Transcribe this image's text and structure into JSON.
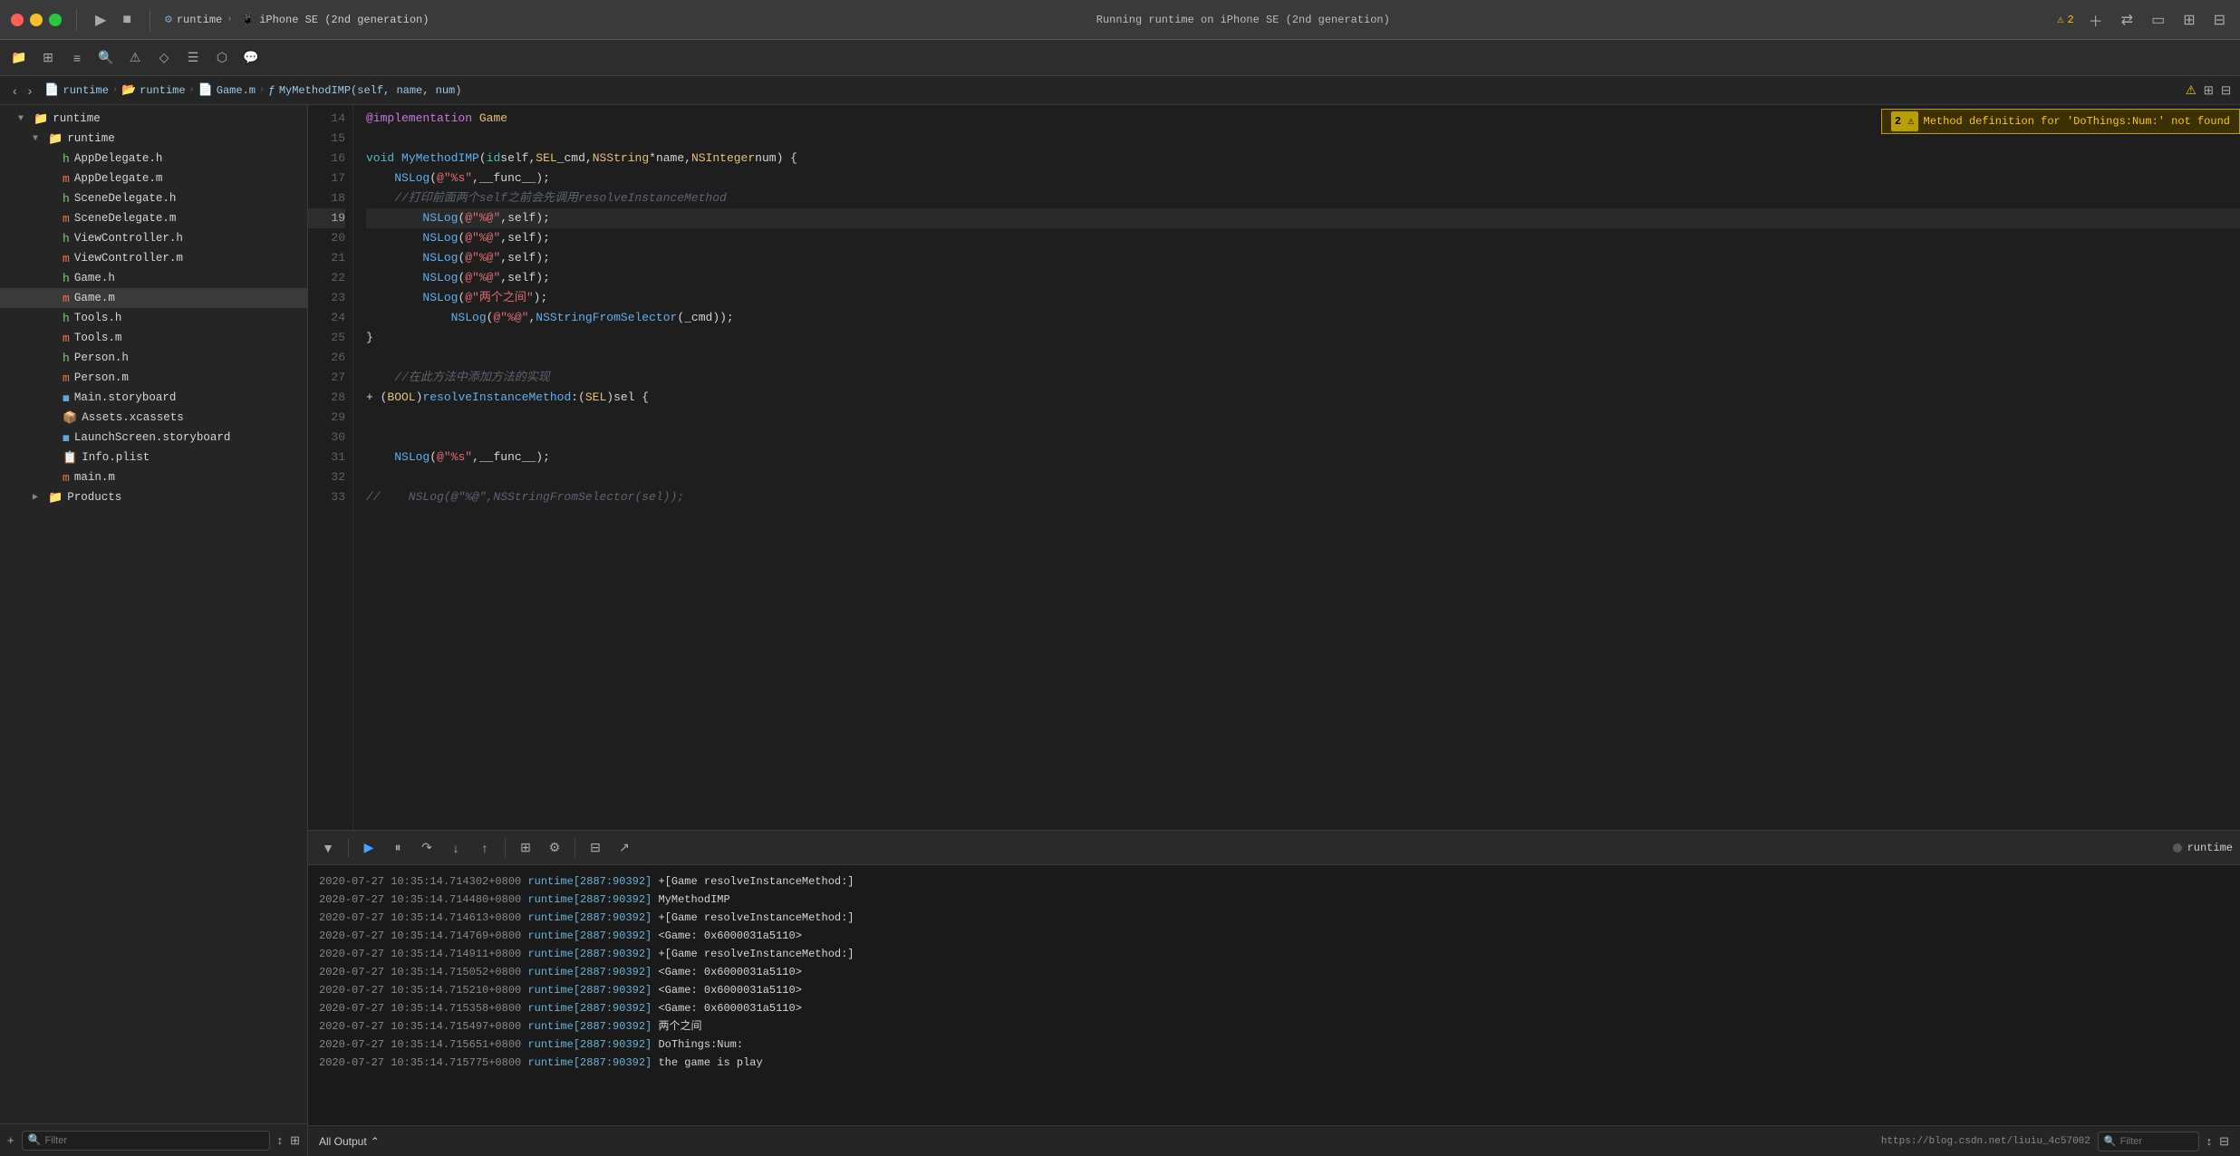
{
  "titleBar": {
    "scheme": "runtime",
    "device": "iPhone SE (2nd generation)",
    "status": "Running runtime on iPhone SE (2nd generation)",
    "warningCount": "2",
    "windowControls": {
      "close": "close",
      "minimize": "minimize",
      "maximize": "maximize"
    }
  },
  "breadcrumb": {
    "items": [
      "runtime",
      "runtime",
      "Game.m",
      "MyMethodIMP(self, name, num)"
    ]
  },
  "sidebar": {
    "rootLabel": "runtime",
    "runtimeLabel": "runtime",
    "files": [
      {
        "name": "AppDelegate.h",
        "type": "h",
        "indent": 2
      },
      {
        "name": "AppDelegate.m",
        "type": "m",
        "indent": 2
      },
      {
        "name": "SceneDelegate.h",
        "type": "h",
        "indent": 2
      },
      {
        "name": "SceneDelegate.m",
        "type": "m",
        "indent": 2
      },
      {
        "name": "ViewController.h",
        "type": "h",
        "indent": 2
      },
      {
        "name": "ViewController.m",
        "type": "m",
        "indent": 2
      },
      {
        "name": "Game.h",
        "type": "h",
        "indent": 2
      },
      {
        "name": "Game.m",
        "type": "m",
        "indent": 2,
        "selected": true
      },
      {
        "name": "Tools.h",
        "type": "h",
        "indent": 2
      },
      {
        "name": "Tools.m",
        "type": "m",
        "indent": 2
      },
      {
        "name": "Person.h",
        "type": "h",
        "indent": 2
      },
      {
        "name": "Person.m",
        "type": "m",
        "indent": 2
      },
      {
        "name": "Main.storyboard",
        "type": "storyboard",
        "indent": 2
      },
      {
        "name": "Assets.xcassets",
        "type": "folder",
        "indent": 2
      },
      {
        "name": "LaunchScreen.storyboard",
        "type": "storyboard",
        "indent": 2
      },
      {
        "name": "Info.plist",
        "type": "plist",
        "indent": 2
      },
      {
        "name": "main.m",
        "type": "m",
        "indent": 2
      },
      {
        "name": "Products",
        "type": "folder-yellow",
        "indent": 1
      }
    ],
    "filterPlaceholder": "Filter"
  },
  "editor": {
    "warningMessage": "Method definition for 'DoThings:Num:' not found",
    "warningLineNum": "2",
    "lines": [
      {
        "num": "14",
        "content": "@implementation Game"
      },
      {
        "num": "15",
        "content": ""
      },
      {
        "num": "16",
        "content": "void MyMethodIMP(id self, SEL _cmd, NSString *name, NSInteger num) {"
      },
      {
        "num": "17",
        "content": "    NSLog(@\"%s\",__func__);"
      },
      {
        "num": "18",
        "content": "    //打印前面两个self之前会先调用resolveInstanceMethod"
      },
      {
        "num": "19",
        "content": "        NSLog(@\"%@\",self);",
        "active": true
      },
      {
        "num": "20",
        "content": "        NSLog(@\"%@\",self);"
      },
      {
        "num": "21",
        "content": "        NSLog(@\"%@\",self);"
      },
      {
        "num": "22",
        "content": "        NSLog(@\"%@\",self);"
      },
      {
        "num": "23",
        "content": "        NSLog(@\"两个之间\");"
      },
      {
        "num": "24",
        "content": "            NSLog(@\"%@\",NSStringFromSelector(_cmd));"
      },
      {
        "num": "25",
        "content": "}"
      },
      {
        "num": "26",
        "content": ""
      },
      {
        "num": "27",
        "content": "    //在此方法中添加方法的实现"
      },
      {
        "num": "28",
        "content": "+ (BOOL)resolveInstanceMethod:(SEL)sel {"
      },
      {
        "num": "29",
        "content": ""
      },
      {
        "num": "30",
        "content": ""
      },
      {
        "num": "31",
        "content": "    NSLog(@\"%s\",__func__);"
      },
      {
        "num": "32",
        "content": ""
      },
      {
        "num": "33",
        "content": "//    NSLog(@\"%@\",NSStringFromSelector(sel));"
      }
    ]
  },
  "console": {
    "lines": [
      "2020-07-27 10:35:14.714302+0800 runtime[2887:90392] +[Game resolveInstanceMethod:]",
      "2020-07-27 10:35:14.714480+0800 runtime[2887:90392] MyMethodIMP",
      "2020-07-27 10:35:14.714613+0800 runtime[2887:90392] +[Game resolveInstanceMethod:]",
      "2020-07-27 10:35:14.714769+0800 runtime[2887:90392] <Game: 0x6000031a5110>",
      "2020-07-27 10:35:14.714911+0800 runtime[2887:90392] +[Game resolveInstanceMethod:]",
      "2020-07-27 10:35:14.715052+0800 runtime[2887:90392] <Game: 0x6000031a5110>",
      "2020-07-27 10:35:14.715210+0800 runtime[2887:90392] <Game: 0x6000031a5110>",
      "2020-07-27 10:35:14.715358+0800 runtime[2887:90392] <Game: 0x6000031a5110>",
      "2020-07-27 10:35:14.715497+0800 runtime[2887:90392] 两个之间",
      "2020-07-27 10:35:14.715651+0800 runtime[2887:90392] DoThings:Num:",
      "2020-07-27 10:35:14.715775+0800 runtime[2887:90392] the game is play"
    ],
    "runtimeLabel": "runtime",
    "allOutputLabel": "All Output",
    "filterPlaceholder": "Filter",
    "url": "https://blog.csdn.net/liuiu_4c57002"
  },
  "toolbar": {
    "buttons": [
      "folder-open-icon",
      "grid-icon",
      "hierarchy-icon",
      "search-icon",
      "warning-icon",
      "bookmark-icon",
      "list-icon",
      "shape-icon",
      "chat-icon"
    ]
  },
  "bottomToolbar": {
    "buttons": [
      "down-arrow-icon",
      "play-icon",
      "pause-icon",
      "step-over-icon",
      "step-in-icon",
      "step-out-icon",
      "breakpoint-icon",
      "debug-icon",
      "console-icon",
      "share-icon"
    ]
  }
}
